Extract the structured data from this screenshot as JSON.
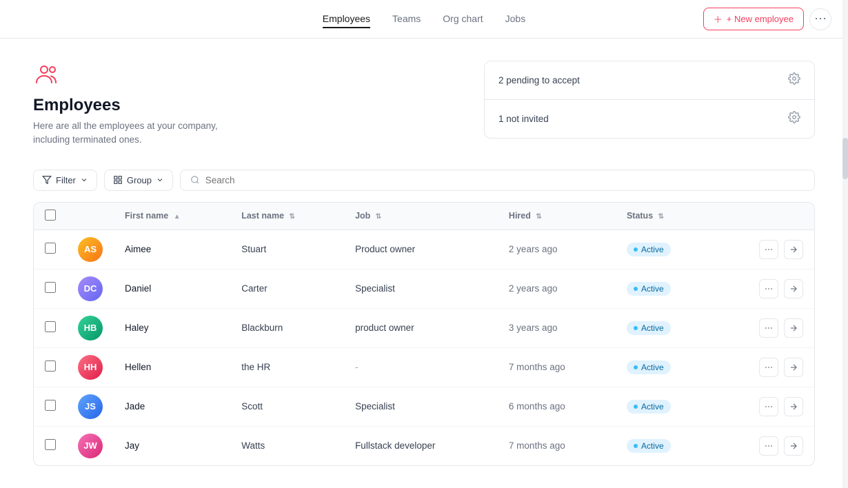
{
  "nav": {
    "items": [
      {
        "id": "employees",
        "label": "Employees",
        "active": true
      },
      {
        "id": "teams",
        "label": "Teams",
        "active": false
      },
      {
        "id": "org-chart",
        "label": "Org chart",
        "active": false
      },
      {
        "id": "jobs",
        "label": "Jobs",
        "active": false
      }
    ],
    "new_employee_label": "+ New employee"
  },
  "header": {
    "title": "Employees",
    "description": "Here are all the employees at your company,\nincluding terminated ones.",
    "alerts": [
      {
        "id": "pending",
        "text": "2 pending to accept"
      },
      {
        "id": "not-invited",
        "text": "1 not invited"
      }
    ]
  },
  "filter_bar": {
    "filter_label": "Filter",
    "group_label": "Group",
    "search_placeholder": "Search"
  },
  "table": {
    "columns": [
      {
        "id": "select",
        "label": ""
      },
      {
        "id": "avatar",
        "label": ""
      },
      {
        "id": "first_name",
        "label": "First name",
        "sortable": true
      },
      {
        "id": "last_name",
        "label": "Last name",
        "sortable": true
      },
      {
        "id": "job",
        "label": "Job",
        "sortable": true
      },
      {
        "id": "hired",
        "label": "Hired",
        "sortable": true
      },
      {
        "id": "status",
        "label": "Status",
        "sortable": true
      }
    ],
    "rows": [
      {
        "id": 1,
        "first_name": "Aimee",
        "last_name": "Stuart",
        "job": "Product owner",
        "hired": "2 years ago",
        "status": "Active",
        "avatar_color": "av1",
        "initials": "AS"
      },
      {
        "id": 2,
        "first_name": "Daniel",
        "last_name": "Carter",
        "job": "Specialist",
        "hired": "2 years ago",
        "status": "Active",
        "avatar_color": "av2",
        "initials": "DC"
      },
      {
        "id": 3,
        "first_name": "Haley",
        "last_name": "Blackburn",
        "job": "product owner",
        "hired": "3 years ago",
        "status": "Active",
        "avatar_color": "av3",
        "initials": "HB"
      },
      {
        "id": 4,
        "first_name": "Hellen",
        "last_name": "the HR",
        "job": "-",
        "hired": "7 months ago",
        "status": "Active",
        "avatar_color": "av4",
        "initials": "HH"
      },
      {
        "id": 5,
        "first_name": "Jade",
        "last_name": "Scott",
        "job": "Specialist",
        "hired": "6 months ago",
        "status": "Active",
        "avatar_color": "av5",
        "initials": "JS"
      },
      {
        "id": 6,
        "first_name": "Jay",
        "last_name": "Watts",
        "job": "Fullstack developer",
        "hired": "7 months ago",
        "status": "Active",
        "avatar_color": "av6",
        "initials": "JW"
      }
    ]
  }
}
